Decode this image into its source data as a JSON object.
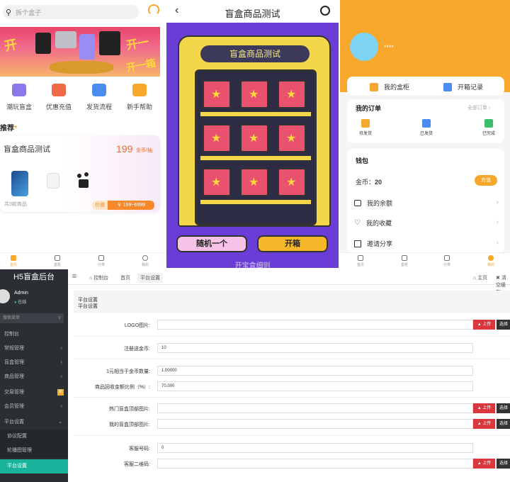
{
  "home": {
    "search_placeholder": "拆个盒子",
    "quick": [
      "潮玩盲盒",
      "优惠充值",
      "发货流程",
      "新手帮助"
    ],
    "recommend_title": "推荐",
    "card": {
      "title": "盲盒商品测试",
      "price": "199",
      "unit": "金币/抽",
      "count": "共3款商品",
      "price_range_label": "价值",
      "price_range": "￥ 199~6999"
    },
    "tabs": [
      "首页",
      "盒柜",
      "分类",
      "我的"
    ]
  },
  "blindbox": {
    "title": "盲盒商品测试",
    "cabinet_title": "盲盒商品测试",
    "btn_random": "随机一个",
    "btn_open": "开箱",
    "rules": "开宝盒细则"
  },
  "profile": {
    "username": "****",
    "tab_box": "我的盒柜",
    "tab_records": "开箱记录",
    "orders_title": "我的订单",
    "all_orders": "全部订单",
    "order_status": [
      "待发货",
      "已发货",
      "已完成"
    ],
    "wallet_title": "钱包",
    "coins_label": "金币：",
    "coins_value": "20",
    "recharge": "充值",
    "menu": [
      "我的余额",
      "我的收藏",
      "邀请分享"
    ],
    "tabs": [
      "首页",
      "盒柜",
      "分类",
      "我的"
    ]
  },
  "admin": {
    "brand": "H5盲盒后台",
    "user": "Admin",
    "status": "在线",
    "search_placeholder": "搜索菜单",
    "menu": [
      "控制台",
      "常规管理",
      "盲盒管理",
      "商品管理",
      "交易管理",
      "会员管理",
      "平台设置",
      "协议配置",
      "轮播图管理",
      "平台设置"
    ],
    "badge": "新",
    "topnav": [
      "控制台",
      "首页",
      "平台设置"
    ],
    "top_right": [
      "主页",
      "清空缓存"
    ],
    "crumb_title": "平台设置",
    "crumb_sub": "平台设置",
    "upload": "上传",
    "choose": "选择",
    "fields": [
      {
        "label": "LOGO图片:",
        "value": ""
      },
      {
        "label": "注册送金币:",
        "value": "10"
      },
      {
        "label": "1元相当于金币数量:",
        "value": "1.00000"
      },
      {
        "label": "商品回收金额比例（%）:",
        "value": "70.000"
      },
      {
        "label": "热门盲盒顶部图片:",
        "value": ""
      },
      {
        "label": "我的盲盒顶部图片:",
        "value": ""
      },
      {
        "label": "客服号码:",
        "value": "0"
      },
      {
        "label": "客服二维码:",
        "value": ""
      }
    ]
  }
}
